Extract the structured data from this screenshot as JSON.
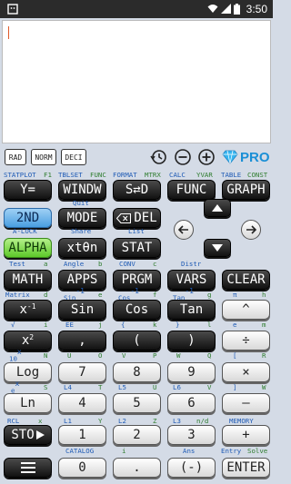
{
  "status": {
    "time": "3:50"
  },
  "toolbar": {
    "rad": "RAD",
    "norm": "NORM",
    "deci": "DECI",
    "pro": "PRO"
  },
  "top_labels": {
    "statplot": "STATPLOT",
    "f1": "F1",
    "tblset": "TBLSET",
    "func": "FUNC",
    "format": "FORMAT",
    "mtrx": "MTRX",
    "calc": "CALC",
    "yvar": "YVAR",
    "table": "TABLE",
    "const": "CONST"
  },
  "rows": {
    "r1": {
      "y": "Y=",
      "window": "WINDW",
      "sfrac": "S⇄D",
      "func": "FUNC",
      "graph": "GRAPH"
    },
    "r1_sub": {
      "quit": "Quit"
    },
    "r2": {
      "second": "2ND",
      "mode": "MODE",
      "del": "DEL"
    },
    "r2_sub": {
      "alock": "A-LOCK",
      "share": "Share",
      "list": "List"
    },
    "r3": {
      "alpha": "ALPHA",
      "xt": "xtθn",
      "stat": "STAT"
    },
    "r3_sub": {
      "test": "Test",
      "a": "a",
      "angle": "Angle",
      "b": "b",
      "conv": "CONV",
      "c": "c",
      "distr": "Distr"
    },
    "r4": {
      "math": "MATH",
      "apps": "APPS",
      "prgm": "PRGM",
      "vars": "VARS",
      "clear": "CLEAR"
    },
    "r4_sub": {
      "matrix": "Matrix",
      "d": "d",
      "sin1": "Sin",
      "e": "e",
      "cos1": "Cos",
      "f": "f",
      "tan1": "Tan",
      "g": "g",
      "pi": "π",
      "h": "h"
    },
    "r5": {
      "xinv_base": "x",
      "xinv_exp": "-1",
      "sin": "Sin",
      "cos": "Cos",
      "tan": "Tan",
      "caret": "^"
    },
    "r5_sub": {
      "sqrt": "√",
      "i": "i",
      "ee": "EE",
      "j": "j",
      "lbrace": "{",
      "k": "k",
      "rbrace": "}",
      "l": "l",
      "euler": "e",
      "m": "m"
    },
    "r6": {
      "x2_base": "x",
      "x2_exp": "2",
      "comma": ",",
      "lparen": "(",
      "rparen": ")",
      "div": "÷"
    },
    "r6_sub": {
      "tenx": "10",
      "tenx_exp": "x",
      "n": "N",
      "u": "U",
      "o": "O",
      "v": "V",
      "p": "P",
      "w": "W",
      "q": "Q",
      "bracket": "[",
      "r": "R"
    },
    "r7": {
      "log": "Log",
      "seven": "7",
      "eight": "8",
      "nine": "9",
      "mul": "×"
    },
    "r7_sub": {
      "ex": "e",
      "ex_exp": "x",
      "s": "S",
      "l4": "L4",
      "t": "T",
      "l5": "L5",
      "u2": "U",
      "l6": "L6",
      "v2": "V",
      "bracket2": "]",
      "w2": "W"
    },
    "r8": {
      "ln": "Ln",
      "four": "4",
      "five": "5",
      "six": "6",
      "minus": "—"
    },
    "r8_sub": {
      "rcl": "RCL",
      "x": "x",
      "l1": "L1",
      "y": "Y",
      "l2": "L2",
      "z": "Z",
      "l3": "L3",
      "nd": "n/d",
      "memory": "MEMORY"
    },
    "r9": {
      "sto": "STO",
      "one": "1",
      "two": "2",
      "three": "3",
      "plus": "+"
    },
    "r9_sub": {
      "catalog": "CATALOG",
      "i": "i",
      "ans": "Ans",
      "entry": "Entry",
      "solve": "Solve"
    },
    "r10": {
      "zero": "0",
      "dot": ".",
      "neg": "(-)",
      "enter": "ENTER"
    }
  }
}
